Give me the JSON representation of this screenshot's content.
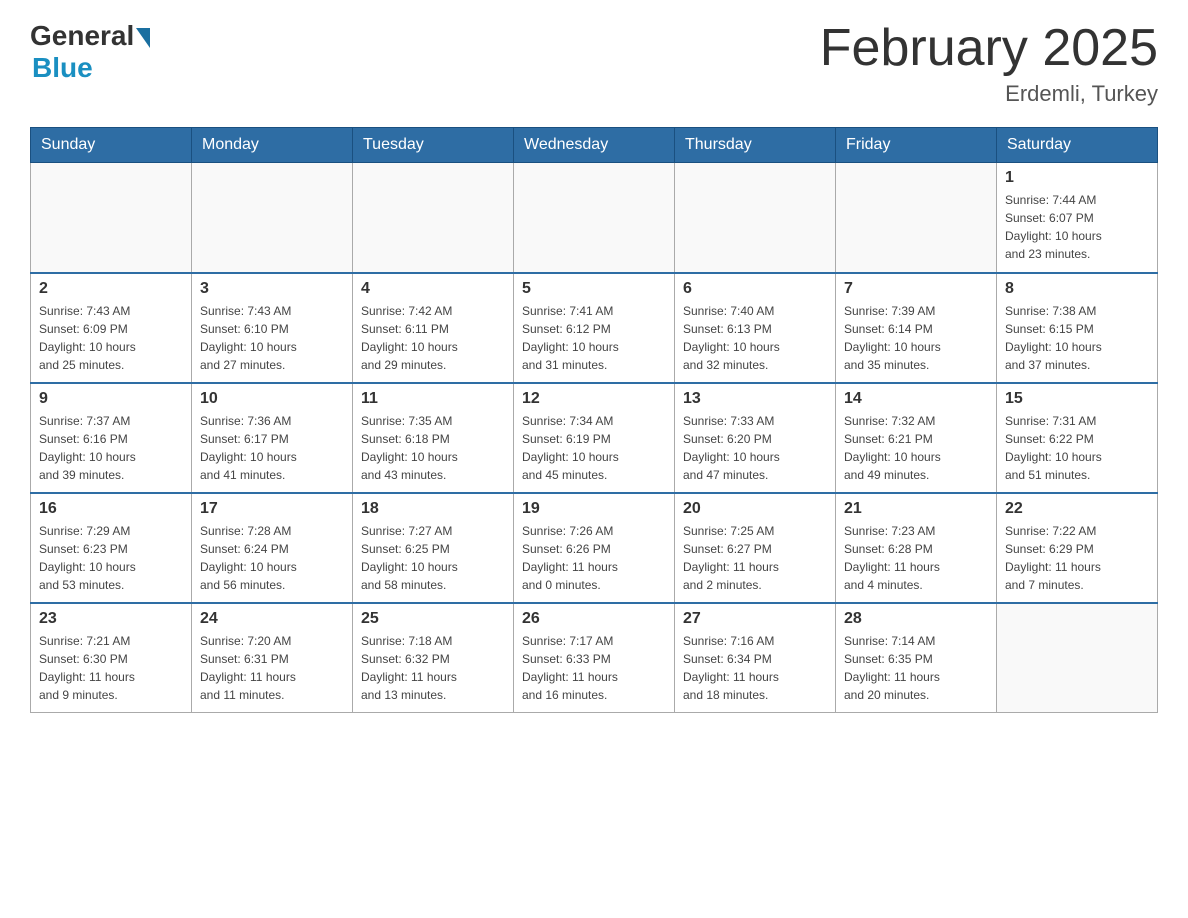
{
  "header": {
    "logo_general": "General",
    "logo_blue": "Blue",
    "month_title": "February 2025",
    "location": "Erdemli, Turkey"
  },
  "days_of_week": [
    "Sunday",
    "Monday",
    "Tuesday",
    "Wednesday",
    "Thursday",
    "Friday",
    "Saturday"
  ],
  "weeks": [
    [
      {
        "day": "",
        "info": ""
      },
      {
        "day": "",
        "info": ""
      },
      {
        "day": "",
        "info": ""
      },
      {
        "day": "",
        "info": ""
      },
      {
        "day": "",
        "info": ""
      },
      {
        "day": "",
        "info": ""
      },
      {
        "day": "1",
        "info": "Sunrise: 7:44 AM\nSunset: 6:07 PM\nDaylight: 10 hours\nand 23 minutes."
      }
    ],
    [
      {
        "day": "2",
        "info": "Sunrise: 7:43 AM\nSunset: 6:09 PM\nDaylight: 10 hours\nand 25 minutes."
      },
      {
        "day": "3",
        "info": "Sunrise: 7:43 AM\nSunset: 6:10 PM\nDaylight: 10 hours\nand 27 minutes."
      },
      {
        "day": "4",
        "info": "Sunrise: 7:42 AM\nSunset: 6:11 PM\nDaylight: 10 hours\nand 29 minutes."
      },
      {
        "day": "5",
        "info": "Sunrise: 7:41 AM\nSunset: 6:12 PM\nDaylight: 10 hours\nand 31 minutes."
      },
      {
        "day": "6",
        "info": "Sunrise: 7:40 AM\nSunset: 6:13 PM\nDaylight: 10 hours\nand 32 minutes."
      },
      {
        "day": "7",
        "info": "Sunrise: 7:39 AM\nSunset: 6:14 PM\nDaylight: 10 hours\nand 35 minutes."
      },
      {
        "day": "8",
        "info": "Sunrise: 7:38 AM\nSunset: 6:15 PM\nDaylight: 10 hours\nand 37 minutes."
      }
    ],
    [
      {
        "day": "9",
        "info": "Sunrise: 7:37 AM\nSunset: 6:16 PM\nDaylight: 10 hours\nand 39 minutes."
      },
      {
        "day": "10",
        "info": "Sunrise: 7:36 AM\nSunset: 6:17 PM\nDaylight: 10 hours\nand 41 minutes."
      },
      {
        "day": "11",
        "info": "Sunrise: 7:35 AM\nSunset: 6:18 PM\nDaylight: 10 hours\nand 43 minutes."
      },
      {
        "day": "12",
        "info": "Sunrise: 7:34 AM\nSunset: 6:19 PM\nDaylight: 10 hours\nand 45 minutes."
      },
      {
        "day": "13",
        "info": "Sunrise: 7:33 AM\nSunset: 6:20 PM\nDaylight: 10 hours\nand 47 minutes."
      },
      {
        "day": "14",
        "info": "Sunrise: 7:32 AM\nSunset: 6:21 PM\nDaylight: 10 hours\nand 49 minutes."
      },
      {
        "day": "15",
        "info": "Sunrise: 7:31 AM\nSunset: 6:22 PM\nDaylight: 10 hours\nand 51 minutes."
      }
    ],
    [
      {
        "day": "16",
        "info": "Sunrise: 7:29 AM\nSunset: 6:23 PM\nDaylight: 10 hours\nand 53 minutes."
      },
      {
        "day": "17",
        "info": "Sunrise: 7:28 AM\nSunset: 6:24 PM\nDaylight: 10 hours\nand 56 minutes."
      },
      {
        "day": "18",
        "info": "Sunrise: 7:27 AM\nSunset: 6:25 PM\nDaylight: 10 hours\nand 58 minutes."
      },
      {
        "day": "19",
        "info": "Sunrise: 7:26 AM\nSunset: 6:26 PM\nDaylight: 11 hours\nand 0 minutes."
      },
      {
        "day": "20",
        "info": "Sunrise: 7:25 AM\nSunset: 6:27 PM\nDaylight: 11 hours\nand 2 minutes."
      },
      {
        "day": "21",
        "info": "Sunrise: 7:23 AM\nSunset: 6:28 PM\nDaylight: 11 hours\nand 4 minutes."
      },
      {
        "day": "22",
        "info": "Sunrise: 7:22 AM\nSunset: 6:29 PM\nDaylight: 11 hours\nand 7 minutes."
      }
    ],
    [
      {
        "day": "23",
        "info": "Sunrise: 7:21 AM\nSunset: 6:30 PM\nDaylight: 11 hours\nand 9 minutes."
      },
      {
        "day": "24",
        "info": "Sunrise: 7:20 AM\nSunset: 6:31 PM\nDaylight: 11 hours\nand 11 minutes."
      },
      {
        "day": "25",
        "info": "Sunrise: 7:18 AM\nSunset: 6:32 PM\nDaylight: 11 hours\nand 13 minutes."
      },
      {
        "day": "26",
        "info": "Sunrise: 7:17 AM\nSunset: 6:33 PM\nDaylight: 11 hours\nand 16 minutes."
      },
      {
        "day": "27",
        "info": "Sunrise: 7:16 AM\nSunset: 6:34 PM\nDaylight: 11 hours\nand 18 minutes."
      },
      {
        "day": "28",
        "info": "Sunrise: 7:14 AM\nSunset: 6:35 PM\nDaylight: 11 hours\nand 20 minutes."
      },
      {
        "day": "",
        "info": ""
      }
    ]
  ]
}
